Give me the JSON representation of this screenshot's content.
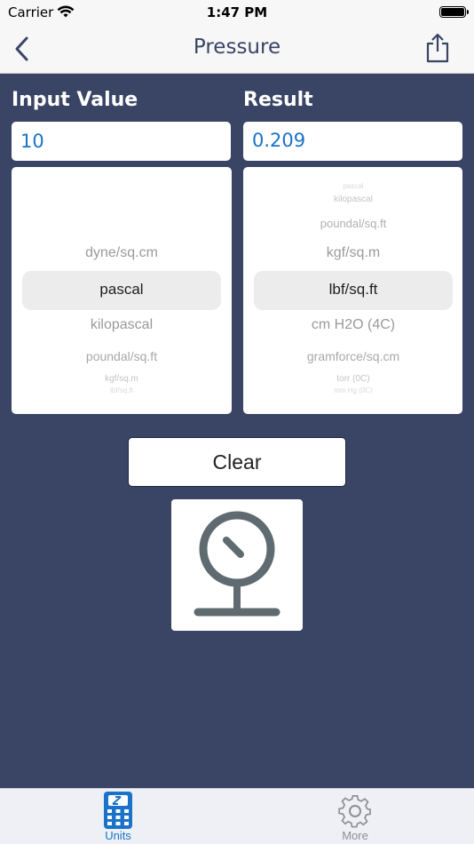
{
  "status": {
    "carrier": "Carrier",
    "time": "1:47 PM"
  },
  "nav": {
    "title": "Pressure",
    "back_icon": "chevron-left-icon",
    "share_icon": "share-icon"
  },
  "input": {
    "label": "Input Value",
    "value": "10",
    "picker": {
      "above": [
        "",
        "",
        "",
        "dyne/sq.cm"
      ],
      "selected": "pascal",
      "below": [
        "kilopascal",
        "poundal/sq.ft",
        "kgf/sq.m",
        "lbf/sq.ft"
      ]
    }
  },
  "result": {
    "label": "Result",
    "value": "0.209",
    "picker": {
      "above": [
        "pascal",
        "kilopascal",
        "poundal/sq.ft",
        "kgf/sq.m"
      ],
      "selected": "lbf/sq.ft",
      "below": [
        "cm H2O (4C)",
        "gramforce/sq.cm",
        "torr (0C)",
        "mm Hg (0C)"
      ]
    }
  },
  "clear_label": "Clear",
  "icon": "pressure-gauge-icon",
  "tabs": [
    {
      "label": "Units",
      "icon": "calculator-icon",
      "active": true
    },
    {
      "label": "More",
      "icon": "gear-icon",
      "active": false
    }
  ],
  "colors": {
    "background": "#3a4565",
    "accent": "#1a73c8",
    "gauge": "#5f6b70"
  }
}
